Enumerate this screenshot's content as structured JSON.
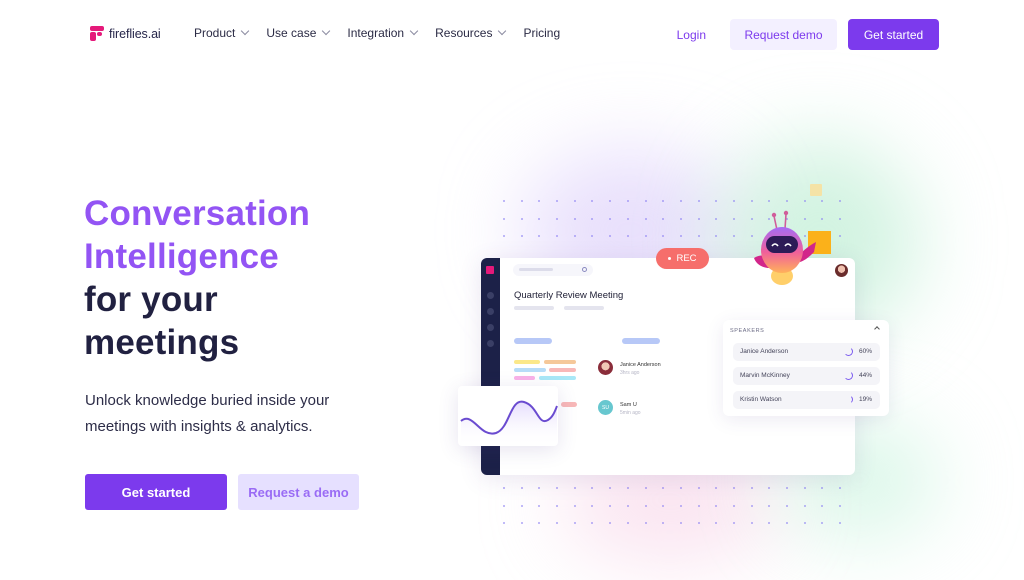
{
  "brand": {
    "name": "fireflies.ai",
    "accent": "#7c3aed",
    "logo_color": "#e5197a"
  },
  "nav": {
    "menu": [
      {
        "label": "Product",
        "has_dropdown": true
      },
      {
        "label": "Use case",
        "has_dropdown": true
      },
      {
        "label": "Integration",
        "has_dropdown": true
      },
      {
        "label": "Resources",
        "has_dropdown": true
      },
      {
        "label": "Pricing",
        "has_dropdown": false
      }
    ],
    "login": "Login",
    "request_demo": "Request demo",
    "get_started": "Get started"
  },
  "hero": {
    "title_accent_1": "Conversation",
    "title_accent_2": "Intelligence",
    "title_dark_1": "for your",
    "title_dark_2": "meetings",
    "subtitle_1": "Unlock knowledge buried inside your",
    "subtitle_2": "meetings with insights & analytics.",
    "cta_primary": "Get started",
    "cta_secondary": "Request a demo"
  },
  "illustration": {
    "rec_label": "REC",
    "meeting_title": "Quarterly Review Meeting",
    "attendees": [
      {
        "name": "Janice Anderson",
        "time": "3hrs ago",
        "initials": ""
      },
      {
        "name": "Sam U",
        "time": "5min ago",
        "initials": "SU"
      }
    ],
    "speakers": {
      "heading": "SPEAKERS",
      "items": [
        {
          "name": "Janice Anderson",
          "percent": "60%"
        },
        {
          "name": "Marvin McKinney",
          "percent": "44%"
        },
        {
          "name": "Kristin Watson",
          "percent": "19%"
        }
      ]
    }
  }
}
